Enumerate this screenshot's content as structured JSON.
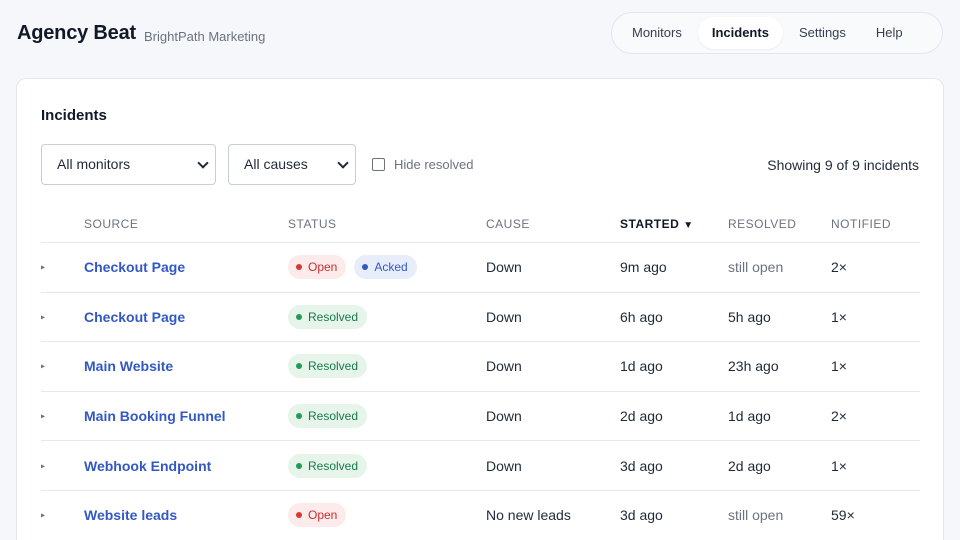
{
  "app": {
    "title": "Agency Beat",
    "org": "BrightPath Marketing"
  },
  "nav": [
    {
      "label": "Monitors",
      "active": false
    },
    {
      "label": "Incidents",
      "active": true
    },
    {
      "label": "Settings",
      "active": false
    },
    {
      "label": "Help",
      "active": false
    }
  ],
  "page": {
    "title": "Incidents"
  },
  "filters": {
    "monitor_select": "All monitors",
    "cause_select": "All causes",
    "hide_resolved_label": "Hide resolved",
    "hide_resolved_checked": false,
    "showing_text": "Showing 9 of 9 incidents"
  },
  "table": {
    "headers": {
      "source": "SOURCE",
      "status": "STATUS",
      "cause": "CAUSE",
      "started": "STARTED",
      "resolved": "RESOLVED",
      "notified": "NOTIFIED"
    },
    "sort_icon": "▼",
    "expander_icon": "▸",
    "rows": [
      {
        "source": "Checkout Page",
        "statuses": [
          {
            "label": "Open",
            "kind": "open"
          },
          {
            "label": "Acked",
            "kind": "acked"
          }
        ],
        "cause": "Down",
        "started": "9m ago",
        "resolved": "still open",
        "notified": "2×"
      },
      {
        "source": "Checkout Page",
        "statuses": [
          {
            "label": "Resolved",
            "kind": "resolved"
          }
        ],
        "cause": "Down",
        "started": "6h ago",
        "resolved": "5h ago",
        "notified": "1×"
      },
      {
        "source": "Main Website",
        "statuses": [
          {
            "label": "Resolved",
            "kind": "resolved"
          }
        ],
        "cause": "Down",
        "started": "1d ago",
        "resolved": "23h ago",
        "notified": "1×"
      },
      {
        "source": "Main Booking Funnel",
        "statuses": [
          {
            "label": "Resolved",
            "kind": "resolved"
          }
        ],
        "cause": "Down",
        "started": "2d ago",
        "resolved": "1d ago",
        "notified": "2×"
      },
      {
        "source": "Webhook Endpoint",
        "statuses": [
          {
            "label": "Resolved",
            "kind": "resolved"
          }
        ],
        "cause": "Down",
        "started": "3d ago",
        "resolved": "2d ago",
        "notified": "1×"
      },
      {
        "source": "Website leads",
        "statuses": [
          {
            "label": "Open",
            "kind": "open"
          }
        ],
        "cause": "No new leads",
        "started": "3d ago",
        "resolved": "still open",
        "notified": "59×"
      }
    ]
  },
  "colors": {
    "link": "#3358c4",
    "open": "#d93636",
    "acked": "#3358c4",
    "resolved": "#1f9d55"
  }
}
